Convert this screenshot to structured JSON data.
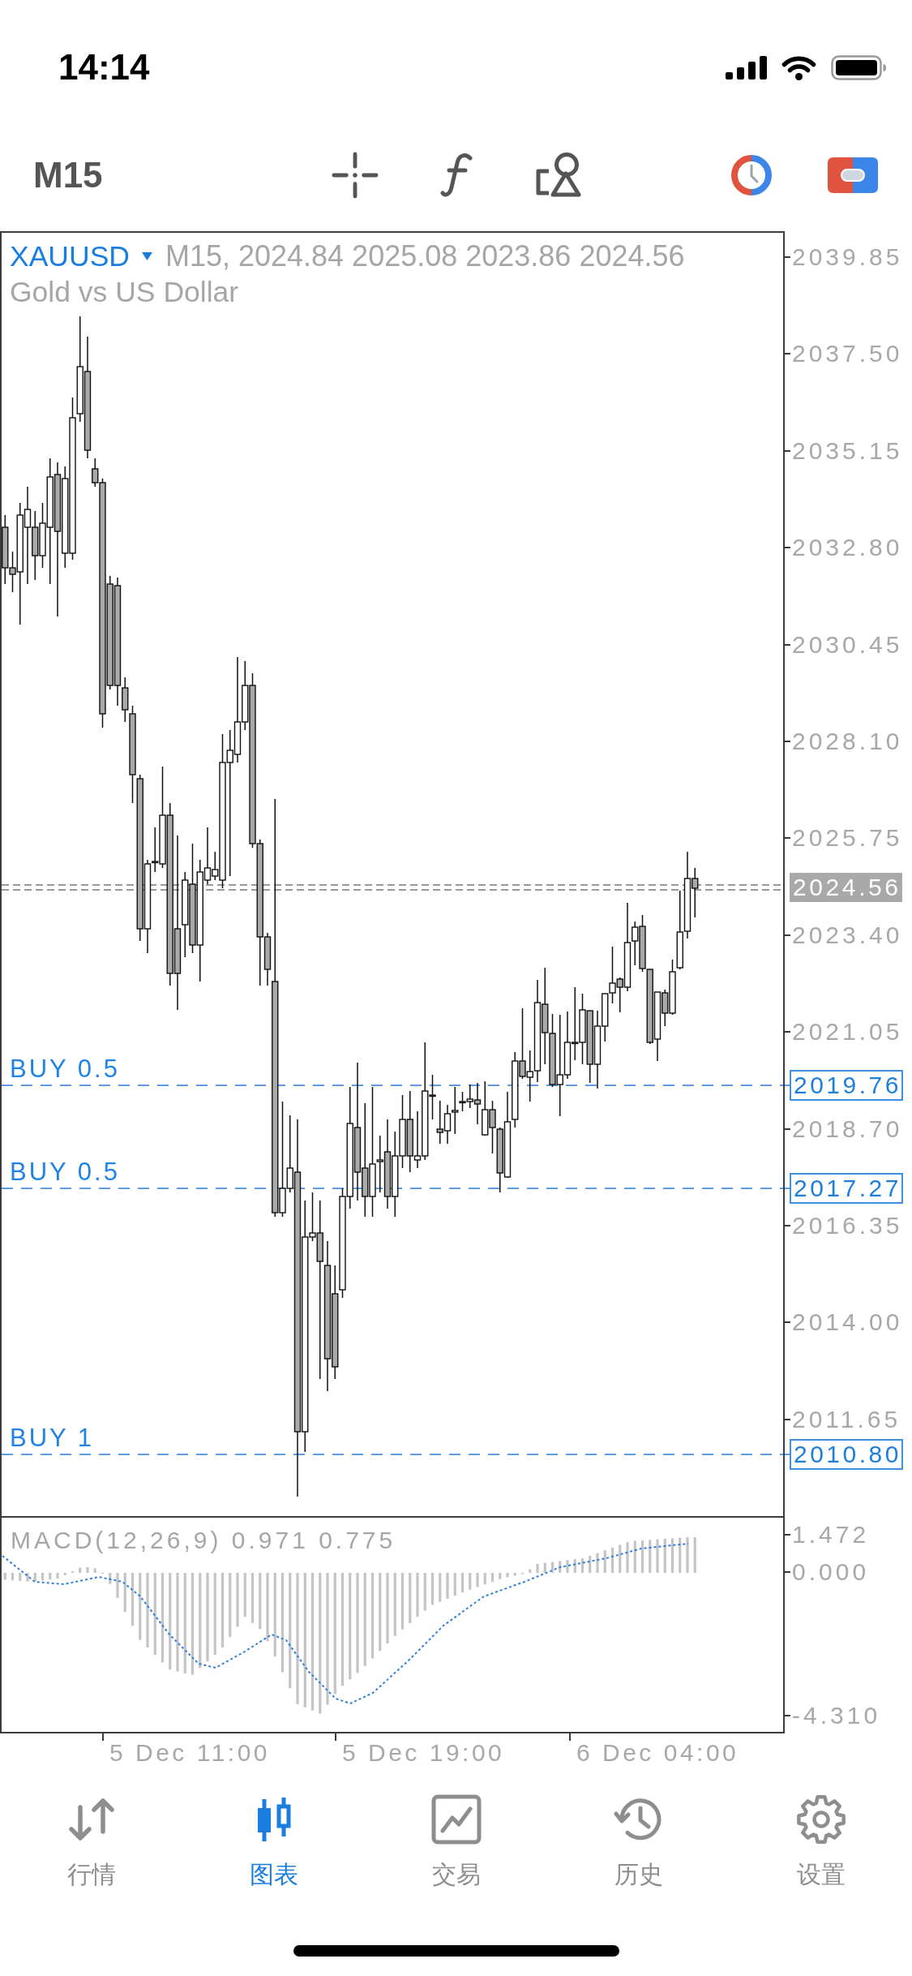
{
  "status_bar": {
    "time": "14:14"
  },
  "toolbar": {
    "timeframe": "M15"
  },
  "chart": {
    "symbol": "XAUUSD",
    "quote": "M15, 2024.84 2025.08 2023.86 2024.56",
    "description": "Gold vs US Dollar",
    "price_axis": [
      "2039.85",
      "2037.50",
      "2035.15",
      "2032.80",
      "2030.45",
      "2028.10",
      "2025.75",
      "2023.40",
      "2021.05",
      "2018.70",
      "2016.35",
      "2014.00",
      "2011.65"
    ],
    "current_price": "2024.56",
    "orders": [
      {
        "label": "BUY 0.5",
        "price": "2019.76"
      },
      {
        "label": "BUY 0.5",
        "price": "2017.27"
      },
      {
        "label": "BUY 1",
        "price": "2010.80"
      }
    ]
  },
  "indicator": {
    "label": "MACD(12,26,9) 0.971 0.775",
    "axis": [
      "1.472",
      "0.000",
      "-4.310"
    ]
  },
  "time_axis": [
    "5 Dec 11:00",
    "5 Dec 19:00",
    "6 Dec 04:00"
  ],
  "tabs": [
    {
      "label": "行情",
      "kind": "quotes",
      "selected": false
    },
    {
      "label": "图表",
      "kind": "chart",
      "selected": true
    },
    {
      "label": "交易",
      "kind": "trade",
      "selected": false
    },
    {
      "label": "历史",
      "kind": "history",
      "selected": false
    },
    {
      "label": "设置",
      "kind": "settings",
      "selected": false
    }
  ]
}
